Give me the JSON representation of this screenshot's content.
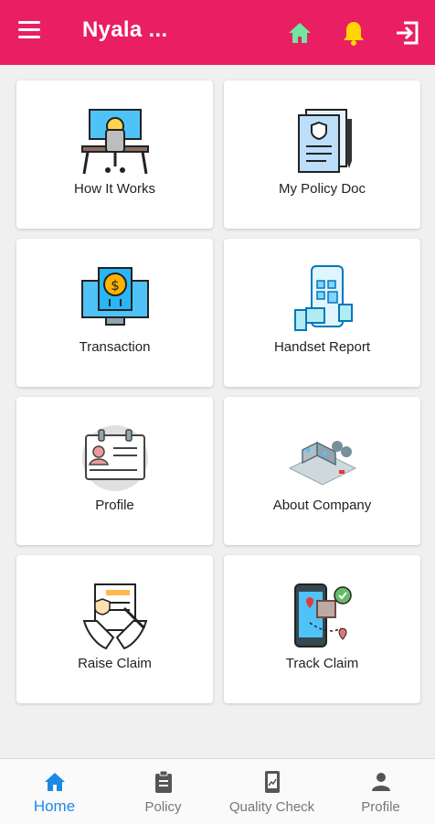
{
  "app": {
    "title": "Nyala ...",
    "accent": "#e91e63"
  },
  "tiles": [
    {
      "label": "How It Works",
      "icon": "desk-computer-icon"
    },
    {
      "label": "My Policy Doc",
      "icon": "policy-document-icon"
    },
    {
      "label": "Transaction",
      "icon": "dollar-monitor-icon"
    },
    {
      "label": "Handset Report",
      "icon": "phone-report-icon"
    },
    {
      "label": "Profile",
      "icon": "id-card-icon"
    },
    {
      "label": "About Company",
      "icon": "factory-icon"
    },
    {
      "label": "Raise Claim",
      "icon": "claim-document-icon"
    },
    {
      "label": "Track Claim",
      "icon": "phone-tracking-icon"
    }
  ],
  "bottom_nav": [
    {
      "label": "Home",
      "icon": "home-icon",
      "active": true
    },
    {
      "label": "Policy",
      "icon": "clipboard-icon",
      "active": false
    },
    {
      "label": "Quality Check",
      "icon": "phone-chart-icon",
      "active": false
    },
    {
      "label": "Profile",
      "icon": "person-icon",
      "active": false
    }
  ],
  "colors": {
    "active_nav": "#1e88e5",
    "home_icon": "#6ee7a0",
    "bell_icon": "#ffd600"
  }
}
